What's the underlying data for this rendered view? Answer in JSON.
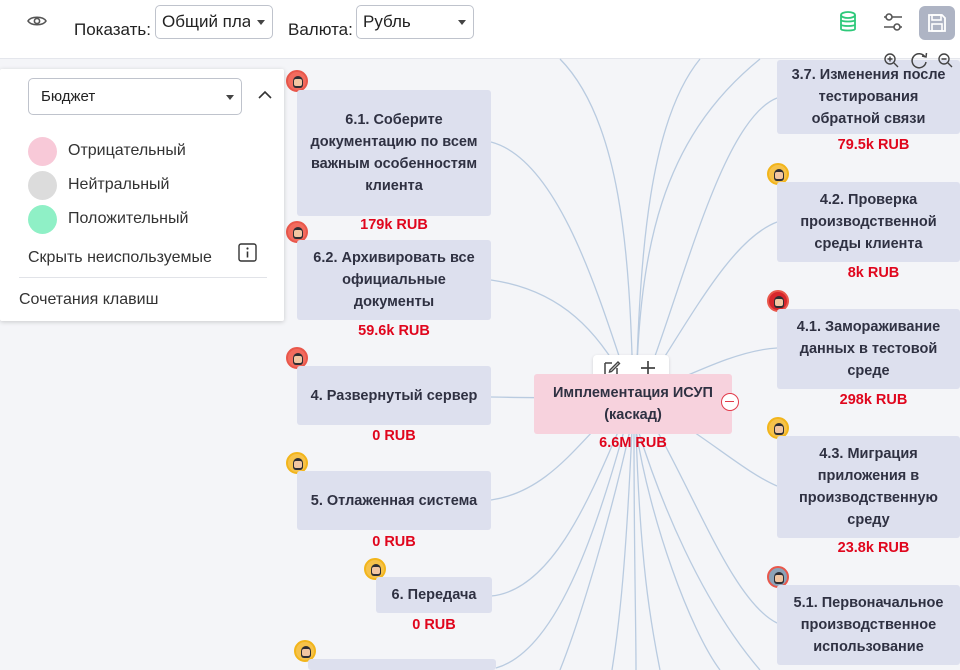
{
  "toolbar": {
    "show_label": "Показать:",
    "show_value": "Общий план",
    "currency_label": "Валюта:",
    "currency_value": "Рубль"
  },
  "icons": {
    "visibility": "eye-icon",
    "database": "database-icon",
    "settings": "sliders-icon",
    "save": "save-icon",
    "zoom_in": "zoom-in-icon",
    "refresh": "refresh-icon",
    "zoom_out": "zoom-out-icon",
    "edit": "edit-icon",
    "add": "plus-icon",
    "collapse": "minus-circle-icon",
    "chevron": "chevron-up-icon",
    "info": "info-icon"
  },
  "colors": {
    "negative": "#f8c9d8",
    "neutral": "#dcdcdc",
    "positive": "#8ff0c6",
    "budget_text": "#e0061d",
    "node_bg": "#dde0ee",
    "root_bg": "#f7d2dd",
    "db_icon": "#2ec97a"
  },
  "panel": {
    "dropdown_value": "Бюджет",
    "legend": [
      {
        "label": "Отрицательный",
        "color": "#f8c9d8"
      },
      {
        "label": "Нейтральный",
        "color": "#dcdcdc"
      },
      {
        "label": "Положительный",
        "color": "#8ff0c6"
      }
    ],
    "hide_unused": "Скрыть неиспользуемые",
    "shortcuts": "Сочетания клавиш"
  },
  "root": {
    "title": "Имплементация ИСУП (каскад)",
    "budget": "6.6M RUB"
  },
  "left_nodes": [
    {
      "title": "6.1. Соберите документацию по всем важным особенностям клиента",
      "budget": "179k RUB"
    },
    {
      "title": "6.2. Архивировать все официальные документы",
      "budget": "59.6k RUB"
    },
    {
      "title": "4. Развернутый сервер",
      "budget": "0 RUB"
    },
    {
      "title": "5. Отлаженная система",
      "budget": "0 RUB"
    },
    {
      "title": "6. Передача",
      "budget": "0 RUB"
    }
  ],
  "right_nodes": [
    {
      "title": "3.7. Изменения после тестирования обратной связи",
      "budget": "79.5k RUB"
    },
    {
      "title": "4.2. Проверка производственной среды клиента",
      "budget": "8k RUB"
    },
    {
      "title": "4.1. Замораживание данных в тестовой среде",
      "budget": "298k RUB"
    },
    {
      "title": "4.3. Миграция приложения в производственную среду",
      "budget": "23.8k RUB"
    },
    {
      "title": "5.1. Первоначальное производственное использование",
      "budget": ""
    }
  ]
}
